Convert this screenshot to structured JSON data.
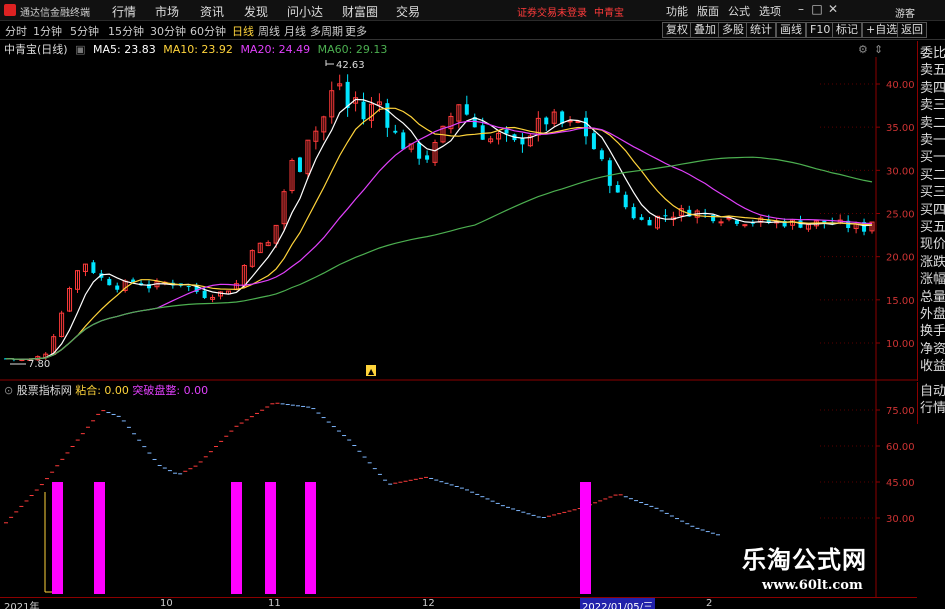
{
  "app": {
    "title": "通达信金融终端",
    "menu": [
      "行情",
      "市场",
      "资讯",
      "发现",
      "问小达",
      "财富圈",
      "交易"
    ],
    "notice": "证券交易未登录",
    "stock_name_red": "中青宝",
    "right_menu": [
      "功能",
      "版面",
      "公式",
      "选项"
    ],
    "guest": "游客",
    "window_buttons": [
      "–",
      "□",
      "✕"
    ]
  },
  "toolbar": {
    "timeframes": [
      "分时",
      "1分钟",
      "5分钟",
      "15分钟",
      "30分钟",
      "60分钟",
      "日线",
      "周线",
      "月线",
      "多周期",
      "更多"
    ],
    "active_timeframe": "日线",
    "right_buttons": [
      "复权",
      "叠加",
      "多股",
      "统计",
      "画线",
      "F10",
      "标记",
      "+自选",
      "返回"
    ]
  },
  "main_info": {
    "stock": "中青宝(日线)",
    "ma": [
      {
        "label": "MA5: 23.83",
        "color": "#ffffff"
      },
      {
        "label": "MA10: 23.92",
        "color": "#ffd43b"
      },
      {
        "label": "MA20: 24.49",
        "color": "#e040fb"
      },
      {
        "label": "MA60: 29.13",
        "color": "#4caf50"
      }
    ],
    "high_label": "42.63",
    "low_label": "7.80",
    "y_ticks": [
      "40.00",
      "35.00",
      "30.00",
      "25.00",
      "20.00",
      "15.00",
      "10.00"
    ]
  },
  "right_panel": [
    "委比",
    "卖五",
    "卖四",
    "卖三",
    "卖二",
    "卖一",
    "买一",
    "买二",
    "买三",
    "买四",
    "买五",
    "现价",
    "涨跌",
    "涨幅",
    "总量",
    "外盘",
    "换手",
    "净资",
    "收益"
  ],
  "right_panel2": [
    "自动",
    "行情"
  ],
  "indicator": {
    "name": "股票指标网",
    "fields": [
      {
        "label": "粘合: 0.00",
        "color": "#ffd43b"
      },
      {
        "label": "突破盘整: 0.00",
        "color": "#e040fb"
      }
    ],
    "y_ticks": [
      "75.00",
      "60.00",
      "45.00",
      "30.00"
    ]
  },
  "time_axis": {
    "labels": [
      "2021年",
      "10",
      "11",
      "12",
      "2022/01/05/三",
      "2"
    ]
  },
  "watermark": {
    "text": "乐淘公式网",
    "url": "www.60lt.com"
  },
  "colors": {
    "up": "#ff3b3b",
    "down": "#00e5ff",
    "ma5": "#ffffff",
    "ma10": "#ffd43b",
    "ma20": "#e040fb",
    "ma60": "#4caf50",
    "grid": "#8b0000",
    "magenta_bar": "#ff00ff"
  }
}
